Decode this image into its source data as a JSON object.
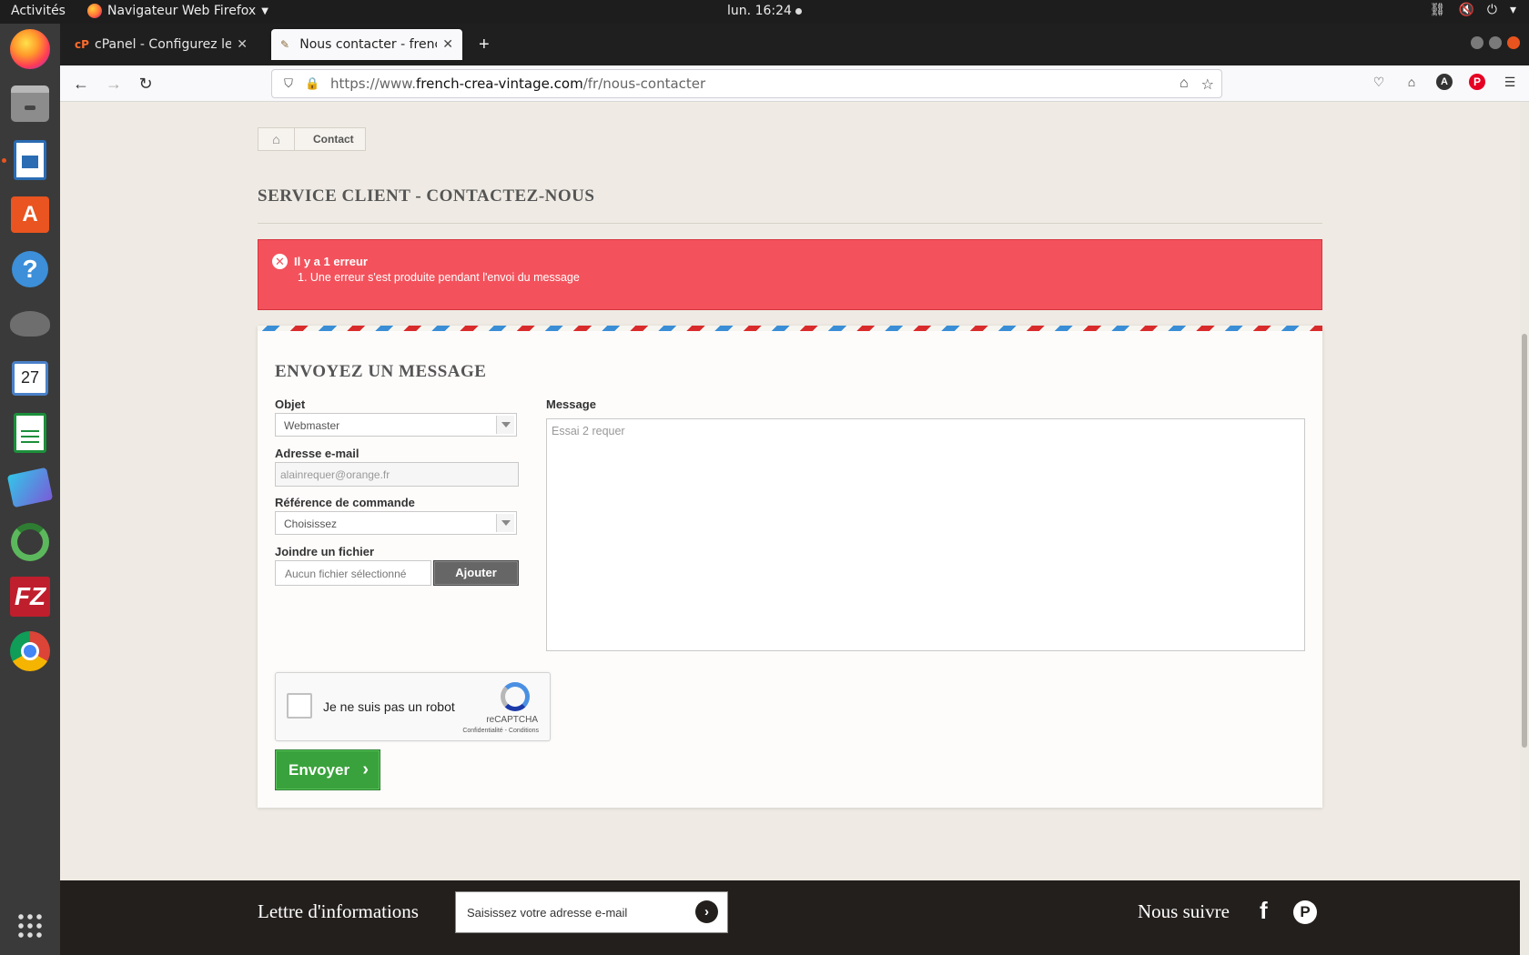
{
  "os": {
    "activities": "Activités",
    "app_name": "Navigateur Web Firefox",
    "clock": "lun. 16:24",
    "calendar_day": "27",
    "store_letter": "A",
    "help_symbol": "?",
    "filezilla_label": "FZ",
    "dock_items": [
      "firefox-icon",
      "files-icon",
      "libreoffice-writer-icon",
      "software-store-icon",
      "help-icon",
      "gimp-icon",
      "calendar-icon",
      "libreoffice-calc-icon",
      "pdf-shuffler-icon",
      "sync-icon",
      "filezilla-icon",
      "chrome-icon",
      "show-apps-icon"
    ]
  },
  "browser": {
    "tabs": [
      {
        "title": "cPanel - Configurez le client",
        "favicon": "cP",
        "active": false
      },
      {
        "title": "Nous contacter - frenchcrea",
        "favicon": "✎",
        "active": true
      }
    ],
    "url_prefix": "https://www.",
    "url_domain": "french-crea-vintage.com",
    "url_path": "/fr/nous-contacter"
  },
  "page": {
    "breadcrumb": {
      "current": "Contact"
    },
    "title": "SERVICE CLIENT - CONTACTEZ-NOUS",
    "alert": {
      "heading": "Il y a 1 erreur",
      "errors": [
        "1. Une erreur s'est produite pendant l'envoi du message"
      ]
    },
    "form": {
      "title": "ENVOYEZ UN MESSAGE",
      "subject_label": "Objet",
      "subject_value": "Webmaster",
      "email_label": "Adresse e-mail",
      "email_value": "alainrequer@orange.fr",
      "order_label": "Référence de commande",
      "order_value": "Choisissez",
      "file_label": "Joindre un fichier",
      "file_placeholder": "Aucun fichier sélectionné",
      "file_button": "Ajouter",
      "message_label": "Message",
      "message_value": "Essai 2 requer",
      "captcha_label": "Je ne suis pas un robot",
      "captcha_brand": "reCAPTCHA",
      "captcha_terms": "Confidentialité - Conditions",
      "submit": "Envoyer"
    },
    "footer": {
      "newsletter_title": "Lettre d'informations",
      "newsletter_placeholder": "Saisissez votre adresse e-mail",
      "follow_title": "Nous suivre"
    }
  },
  "colors": {
    "error": "#f3525c",
    "submit": "#3aa23c",
    "footer": "#231f1d",
    "page_bg": "#efebe4"
  }
}
